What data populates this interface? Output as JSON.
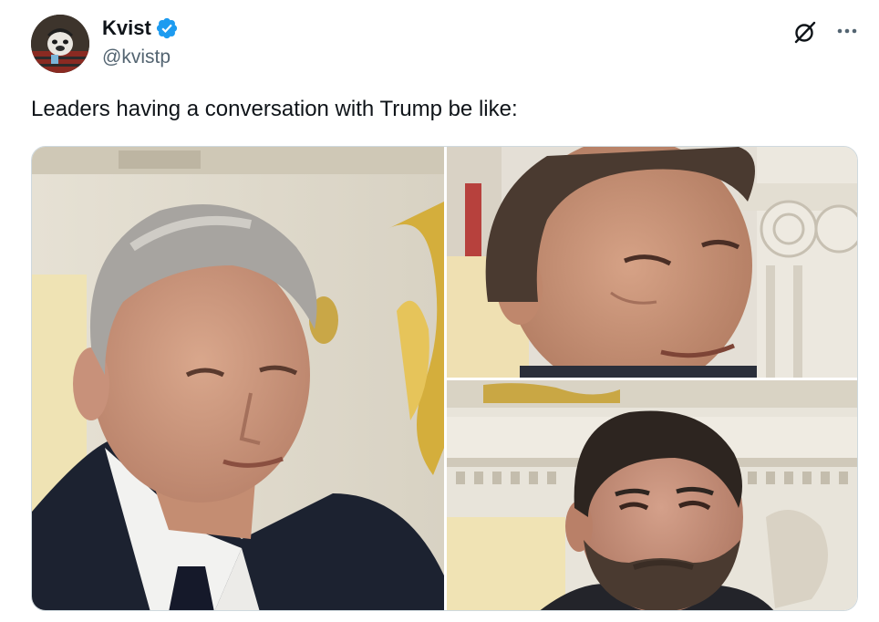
{
  "author": {
    "display_name": "Kvist",
    "handle": "@kvistp",
    "verified": true,
    "avatar_icon": "avatar-image"
  },
  "tweet": {
    "text": "Leaders having a conversation with Trump be like:"
  },
  "actions": {
    "grok_icon": "grok-icon",
    "more_icon": "more-options-icon"
  },
  "media": {
    "photo_count": 3,
    "photos": [
      {
        "name": "photo-left",
        "description_icon": "man-gray-hair-suit-photo"
      },
      {
        "name": "photo-top-right",
        "description_icon": "man-smiling-photo"
      },
      {
        "name": "photo-bottom-right",
        "description_icon": "bearded-man-photo"
      }
    ]
  },
  "colors": {
    "text_primary": "#0f1419",
    "text_secondary": "#536471",
    "verified_blue": "#1d9bf0",
    "border": "#cfd9de"
  }
}
